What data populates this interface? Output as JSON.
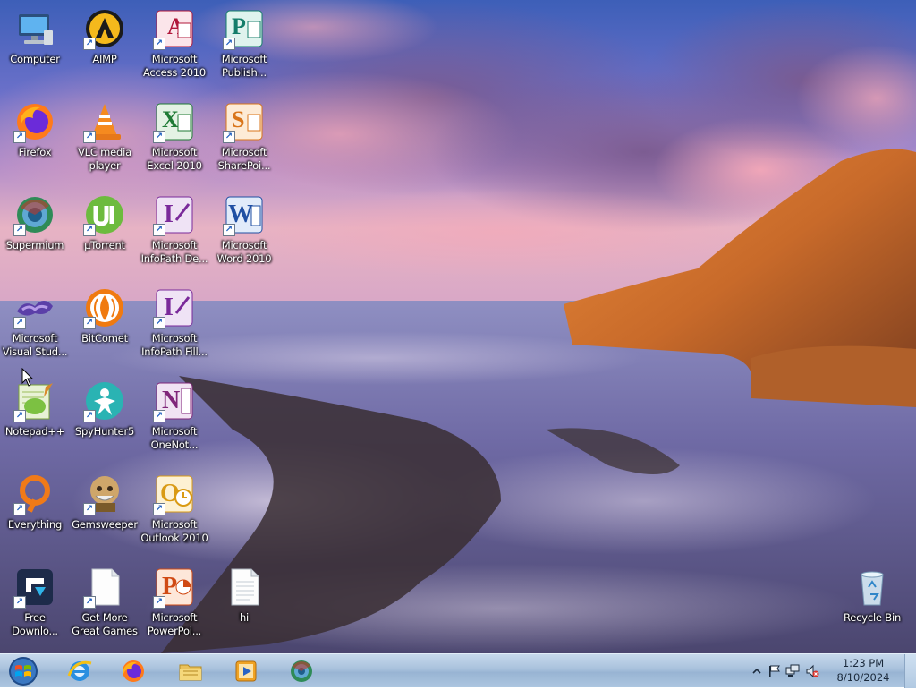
{
  "desktop": {
    "icons": [
      {
        "label": "Computer"
      },
      {
        "label": "AIMP"
      },
      {
        "label": "Microsoft\nAccess 2010"
      },
      {
        "label": "Microsoft\nPublish..."
      },
      {
        "label": "Firefox"
      },
      {
        "label": "VLC media\nplayer"
      },
      {
        "label": "Microsoft\nExcel 2010"
      },
      {
        "label": "Microsoft\nSharePoi..."
      },
      {
        "label": "Supermium"
      },
      {
        "label": "µTorrent"
      },
      {
        "label": "Microsoft\nInfoPath De..."
      },
      {
        "label": "Microsoft\nWord 2010"
      },
      {
        "label": "Microsoft\nVisual Stud..."
      },
      {
        "label": "BitComet"
      },
      {
        "label": "Microsoft\nInfoPath Fill..."
      },
      {
        "label": "Notepad++"
      },
      {
        "label": "SpyHunter5"
      },
      {
        "label": "Microsoft\nOneNot..."
      },
      {
        "label": "Everything"
      },
      {
        "label": "Gemsweeper"
      },
      {
        "label": "Microsoft\nOutlook 2010"
      },
      {
        "label": "Free\nDownlo..."
      },
      {
        "label": "Get More\nGreat Games"
      },
      {
        "label": "Microsoft\nPowerPoi..."
      },
      {
        "label": "hi"
      },
      {
        "label": "Recycle Bin"
      }
    ]
  },
  "taskbar": {
    "pinned": [
      "internet-explorer",
      "firefox",
      "file-explorer",
      "media-player",
      "supermium"
    ]
  },
  "tray": {
    "time": "1:23 PM",
    "date": "8/10/2024"
  },
  "colors": {
    "taskbar": "#a8c1dc",
    "label_text": "#ffffff"
  }
}
